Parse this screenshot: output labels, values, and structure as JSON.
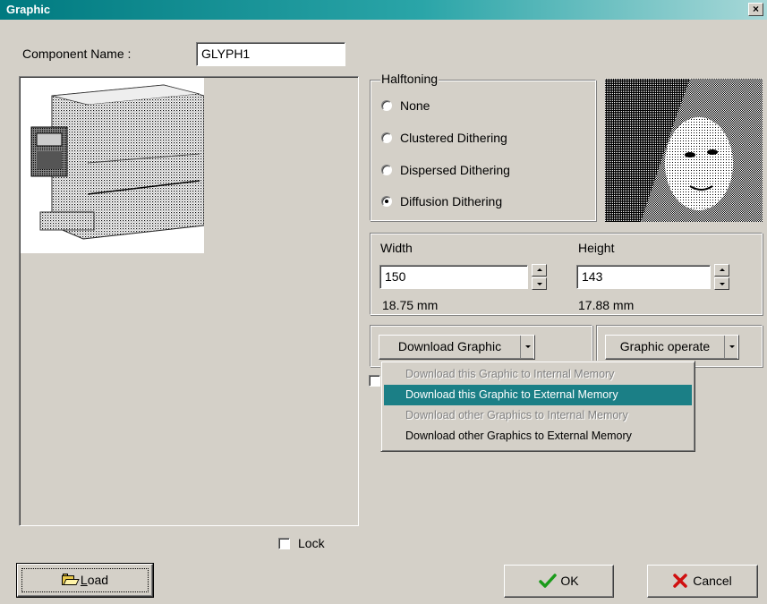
{
  "window": {
    "title": "Graphic",
    "close_glyph": "×"
  },
  "component": {
    "label": "Component Name :",
    "value": "GLYPH1"
  },
  "halftoning": {
    "group_label": "Halftoning",
    "options": [
      {
        "label": "None",
        "checked": false
      },
      {
        "label": "Clustered Dithering",
        "checked": false
      },
      {
        "label": "Dispersed Dithering",
        "checked": false
      },
      {
        "label": "Diffusion Dithering",
        "checked": true
      }
    ]
  },
  "size": {
    "width_label": "Width",
    "width_value": "150",
    "width_mm": "18.75 mm",
    "height_label": "Height",
    "height_value": "143",
    "height_mm": "17.88 mm"
  },
  "download": {
    "button_label": "Download Graphic",
    "menu_items": [
      {
        "label": "Download this Graphic to Internal Memory",
        "state": "disabled"
      },
      {
        "label": "Download this Graphic to External Memory",
        "state": "highlighted"
      },
      {
        "label": "Download other Graphics to Internal Memory",
        "state": "disabled"
      },
      {
        "label": "Download other Graphics to External Memory",
        "state": "enabled"
      }
    ]
  },
  "operate": {
    "button_label": "Graphic operate"
  },
  "lock": {
    "label": "Lock",
    "checked": false
  },
  "buttons": {
    "load_label": "Load",
    "load_mnemonic": "L",
    "load_rest": "oad",
    "ok_label": "OK",
    "cancel_label": "Cancel"
  },
  "icons": {
    "load": "folder-open-icon",
    "ok": "checkmark-icon",
    "cancel": "x-icon",
    "preview_image": "printer-image",
    "halftone_sample": "halftone-sample-image"
  },
  "colors": {
    "titlebar": "#007a80",
    "highlight": "#1b7f86",
    "ok_check": "#1a9b1a",
    "cancel_x": "#d01010"
  }
}
